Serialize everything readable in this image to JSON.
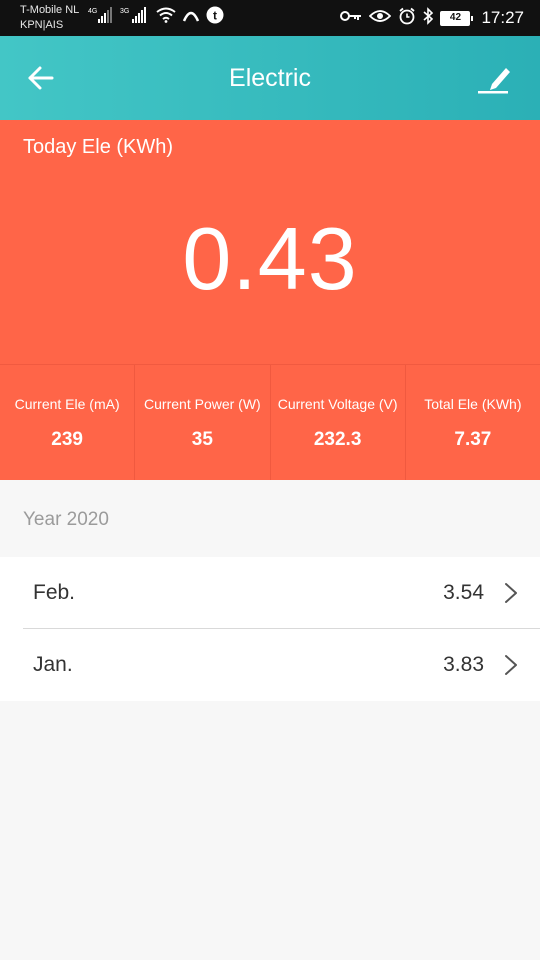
{
  "status_bar": {
    "carrier_line1": "T-Mobile  NL",
    "carrier_line2": "KPN|AIS",
    "net1": "4G",
    "net2": "3G",
    "battery": "42",
    "time": "17:27"
  },
  "app_bar": {
    "title": "Electric",
    "back_icon": "arrow-left-icon",
    "edit_icon": "pencil-icon"
  },
  "today": {
    "label": "Today Ele (KWh)",
    "value": "0.43"
  },
  "stats": [
    {
      "label": "Current Ele (mA)",
      "value": "239"
    },
    {
      "label": "Current Power (W)",
      "value": "35"
    },
    {
      "label": "Current Voltage (V)",
      "value": "232.3"
    },
    {
      "label": "Total Ele (KWh)",
      "value": "7.37"
    }
  ],
  "year": {
    "label": "Year 2020",
    "months": [
      {
        "name": "Feb.",
        "value": "3.54"
      },
      {
        "name": "Jan.",
        "value": "3.83"
      }
    ]
  },
  "colors": {
    "app_bar": "#3dbfc0",
    "header": "#ff6548",
    "background": "#f7f7f7"
  }
}
